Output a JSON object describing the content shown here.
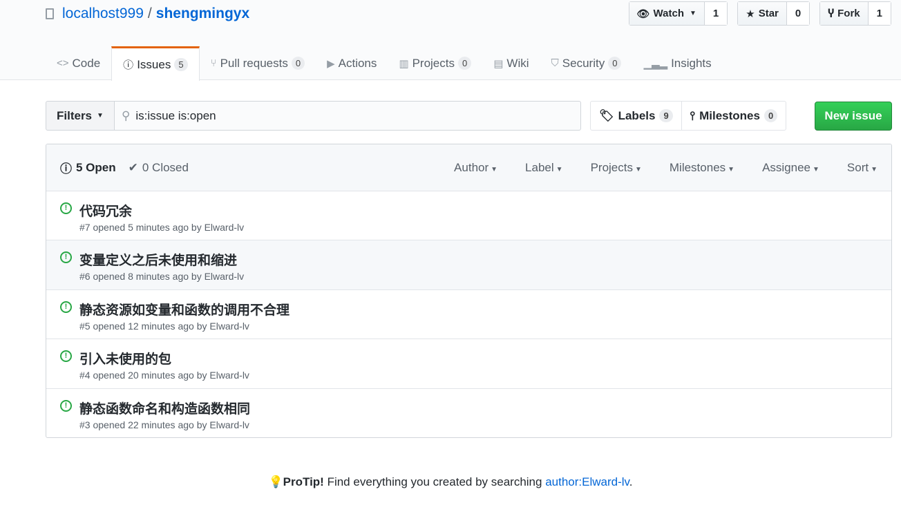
{
  "repo": {
    "owner": "localhost999",
    "name": "shengmingyx"
  },
  "actions": [
    {
      "label": "Watch",
      "count": "1",
      "icon": "eye-icon"
    },
    {
      "label": "Star",
      "count": "0",
      "icon": "star-icon"
    },
    {
      "label": "Fork",
      "count": "1",
      "icon": "fork-icon"
    }
  ],
  "tabs": [
    {
      "label": "Code",
      "icon": "code-icon"
    },
    {
      "label": "Issues",
      "count": "5",
      "icon": "issue-icon",
      "active": true
    },
    {
      "label": "Pull requests",
      "count": "0"
    },
    {
      "label": "Actions"
    },
    {
      "label": "Projects",
      "count": "0"
    },
    {
      "label": "Wiki"
    },
    {
      "label": "Security",
      "count": "0"
    },
    {
      "label": "Insights"
    }
  ],
  "filters": {
    "label": "Filters",
    "query": "is:issue is:open"
  },
  "labels": {
    "label": "Labels",
    "count": "9"
  },
  "milestones": {
    "label": "Milestones",
    "count": "0"
  },
  "new_issue": "New issue",
  "list": {
    "open": "5 Open",
    "closed": "0 Closed",
    "menus": [
      "Author",
      "Label",
      "Projects",
      "Milestones",
      "Assignee",
      "Sort"
    ]
  },
  "issues": [
    {
      "title": "代码冗余",
      "meta": "#7 opened 5 minutes ago by Elward-lv"
    },
    {
      "title": "变量定义之后未使用和缩进",
      "meta": "#6 opened 8 minutes ago by Elward-lv"
    },
    {
      "title": "静态资源如变量和函数的调用不合理",
      "meta": "#5 opened 12 minutes ago by Elward-lv"
    },
    {
      "title": "引入未使用的包",
      "meta": "#4 opened 20 minutes ago by Elward-lv"
    },
    {
      "title": "静态函数命名和构造函数相同",
      "meta": "#3 opened 22 minutes ago by Elward-lv"
    }
  ],
  "protip": {
    "strong": "ProTip!",
    "text": " Find everything you created by searching ",
    "link": "author:Elward-lv",
    "end": "."
  }
}
